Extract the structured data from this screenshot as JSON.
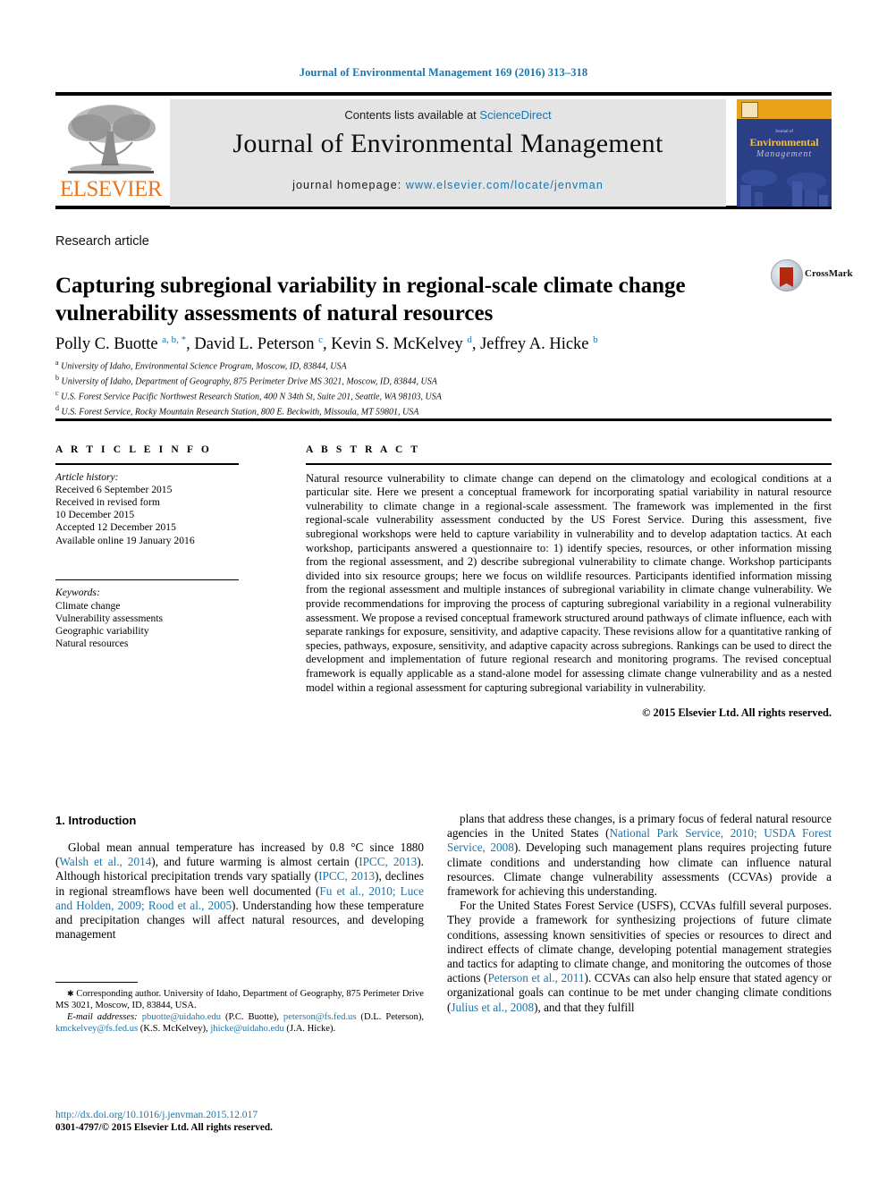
{
  "running_head": "Journal of Environmental Management 169 (2016) 313–318",
  "masthead": {
    "contents_prefix": "Contents lists available at ",
    "sciencedirect": "ScienceDirect",
    "journal_title": "Journal of Environmental Management",
    "homepage_label": "journal homepage: ",
    "homepage_url": "www.elsevier.com/locate/jenvman",
    "publisher": "ELSEVIER",
    "cover": {
      "line_small": "Journal of",
      "line1": "Environmental",
      "line2": "Management"
    }
  },
  "article": {
    "type": "Research article",
    "title": "Capturing subregional variability in regional-scale climate change vulnerability assessments of natural resources",
    "crossmark_label": "CrossMark",
    "authors_html": "Polly C. Buotte <sup>a, b, *</sup>, David L. Peterson <sup>c</sup>, Kevin S. McKelvey <sup>d</sup>, Jeffrey A. Hicke <sup>b</sup>",
    "affiliations": [
      {
        "marker": "a",
        "text": "University of Idaho, Environmental Science Program, Moscow, ID, 83844, USA"
      },
      {
        "marker": "b",
        "text": "University of Idaho, Department of Geography, 875 Perimeter Drive MS 3021, Moscow, ID, 83844, USA"
      },
      {
        "marker": "c",
        "text": "U.S. Forest Service Pacific Northwest Research Station, 400 N 34th St, Suite 201, Seattle, WA 98103, USA"
      },
      {
        "marker": "d",
        "text": "U.S. Forest Service, Rocky Mountain Research Station, 800 E. Beckwith, Missoula, MT 59801, USA"
      }
    ]
  },
  "info": {
    "heading": "A R T I C L E    I N F O",
    "history_label": "Article history:",
    "history": [
      "Received 6 September 2015",
      "Received in revised form",
      "10 December 2015",
      "Accepted 12 December 2015",
      "Available online 19 January 2016"
    ],
    "keywords_label": "Keywords:",
    "keywords": [
      "Climate change",
      "Vulnerability assessments",
      "Geographic variability",
      "Natural resources"
    ]
  },
  "abstract": {
    "heading": "A B S T R A C T",
    "text": "Natural resource vulnerability to climate change can depend on the climatology and ecological conditions at a particular site. Here we present a conceptual framework for incorporating spatial variability in natural resource vulnerability to climate change in a regional-scale assessment. The framework was implemented in the first regional-scale vulnerability assessment conducted by the US Forest Service. During this assessment, five subregional workshops were held to capture variability in vulnerability and to develop adaptation tactics. At each workshop, participants answered a questionnaire to: 1) identify species, resources, or other information missing from the regional assessment, and 2) describe subregional vulnerability to climate change. Workshop participants divided into six resource groups; here we focus on wildlife resources. Participants identified information missing from the regional assessment and multiple instances of subregional variability in climate change vulnerability. We provide recommendations for improving the process of capturing subregional variability in a regional vulnerability assessment. We propose a revised conceptual framework structured around pathways of climate influence, each with separate rankings for exposure, sensitivity, and adaptive capacity. These revisions allow for a quantitative ranking of species, pathways, exposure, sensitivity, and adaptive capacity across subregions. Rankings can be used to direct the development and implementation of future regional research and monitoring programs. The revised conceptual framework is equally applicable as a stand-alone model for assessing climate change vulnerability and as a nested model within a regional assessment for capturing subregional variability in vulnerability.",
    "copyright": "© 2015 Elsevier Ltd. All rights reserved."
  },
  "body": {
    "section_heading": "1. Introduction",
    "left_paragraph_html": "Global mean annual temperature has increased by 0.8 °C since 1880 (<a class=\"ref\" href=\"#\">Walsh et al., 2014</a>), and future warming is almost certain (<a class=\"ref\" href=\"#\">IPCC, 2013</a>). Although historical precipitation trends vary spatially (<a class=\"ref\" href=\"#\">IPCC, 2013</a>), declines in regional streamflows have been well documented (<a class=\"ref\" href=\"#\">Fu et al., 2010; Luce and Holden, 2009; Rood et al., 2005</a>). Understanding how these temperature and precipitation changes will affect natural resources, and developing management",
    "right_paragraph1_html": "plans that address these changes, is a primary focus of federal natural resource agencies in the United States (<a class=\"ref\" href=\"#\">National Park Service, 2010; USDA Forest Service, 2008</a>). Developing such management plans requires projecting future climate conditions and understanding how climate can influence natural resources. Climate change vulnerability assessments (CCVAs) provide a framework for achieving this understanding.",
    "right_paragraph2_html": "For the United States Forest Service (USFS), CCVAs fulfill several purposes. They provide a framework for synthesizing projections of future climate conditions, assessing known sensitivities of species or resources to direct and indirect effects of climate change, developing potential management strategies and tactics for adapting to climate change, and monitoring the outcomes of those actions (<a class=\"ref\" href=\"#\">Peterson et al., 2011</a>). CCVAs can also help ensure that stated agency or organizational goals can continue to be met under changing climate conditions (<a class=\"ref\" href=\"#\">Julius et al., 2008</a>), and that they fulfill"
  },
  "footnotes": {
    "corresponding_html": "<span style=\"font-size:9px\">✱</span> Corresponding author. University of Idaho, Department of Geography, 875 Perimeter Drive MS 3021, Moscow, ID, 83844, USA.",
    "emails_html": "<span class=\"em\">E-mail addresses:</span> <a href=\"#\">pbuotte@uidaho.edu</a> (P.C. Buotte), <a href=\"#\">peterson@fs.fed.us</a> (D.L. Peterson), <a href=\"#\">kmckelvey@fs.fed.us</a> (K.S. McKelvey), <a href=\"#\">jhicke@uidaho.edu</a> (J.A. Hicke).",
    "doi": "http://dx.doi.org/10.1016/j.jenvman.2015.12.017",
    "issn": "0301-4797/© 2015 Elsevier Ltd. All rights reserved."
  },
  "colors": {
    "link": "#1b75ab",
    "elsevier_orange": "#E87722",
    "banner_gray": "#e4e4e4",
    "cover_blue": "#2a3f86"
  }
}
